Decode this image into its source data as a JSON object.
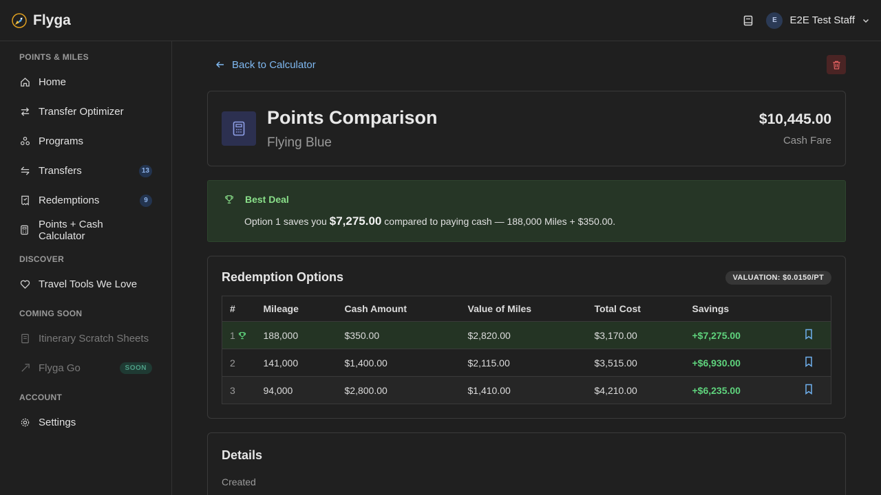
{
  "app": {
    "name": "Flyga"
  },
  "user": {
    "initial": "E",
    "name": "E2E Test Staff"
  },
  "sidebar": {
    "sections": [
      {
        "label": "POINTS & MILES"
      },
      {
        "label": "DISCOVER"
      },
      {
        "label": "COMING SOON"
      },
      {
        "label": "ACCOUNT"
      }
    ],
    "items": [
      {
        "label": "Home",
        "icon": "home-icon"
      },
      {
        "label": "Transfer Optimizer",
        "icon": "arrows-icon"
      },
      {
        "label": "Programs",
        "icon": "programs-icon"
      },
      {
        "label": "Transfers",
        "icon": "transfers-icon",
        "count": "13"
      },
      {
        "label": "Redemptions",
        "icon": "receipt-icon",
        "count": "9"
      },
      {
        "label": "Points + Cash Calculator",
        "icon": "calculator-icon"
      },
      {
        "label": "Travel Tools We Love",
        "icon": "heart-icon"
      },
      {
        "label": "Itinerary Scratch Sheets",
        "icon": "document-icon"
      },
      {
        "label": "Flyga Go",
        "icon": "rocket-icon",
        "badge": "SOON"
      },
      {
        "label": "Settings",
        "icon": "gear-icon"
      }
    ]
  },
  "main": {
    "back_label": "Back to Calculator",
    "title": "Points Comparison",
    "subtitle": "Flying Blue",
    "fare_amount": "$10,445.00",
    "fare_label": "Cash Fare",
    "best_deal": {
      "title": "Best Deal",
      "prefix": "Option 1 saves you",
      "amount": "$7,275.00",
      "suffix": "compared to paying cash — 188,000 Miles + $350.00."
    },
    "options": {
      "title": "Redemption Options",
      "valuation": "VALUATION: $0.0150/PT",
      "columns": [
        "#",
        "Mileage",
        "Cash Amount",
        "Value of Miles",
        "Total Cost",
        "Savings"
      ],
      "rows": [
        {
          "num": "1",
          "mileage": "188,000",
          "cash": "$350.00",
          "value": "$2,820.00",
          "total": "$3,170.00",
          "savings": "+$7,275.00"
        },
        {
          "num": "2",
          "mileage": "141,000",
          "cash": "$1,400.00",
          "value": "$2,115.00",
          "total": "$3,515.00",
          "savings": "+$6,930.00"
        },
        {
          "num": "3",
          "mileage": "94,000",
          "cash": "$2,800.00",
          "value": "$1,410.00",
          "total": "$4,210.00",
          "savings": "+$6,235.00"
        }
      ]
    },
    "details": {
      "title": "Details",
      "created_label": "Created"
    }
  },
  "colors": {
    "accent": "#7fb8f0",
    "success": "#5fd47d",
    "danger_bg": "#4a2424"
  }
}
